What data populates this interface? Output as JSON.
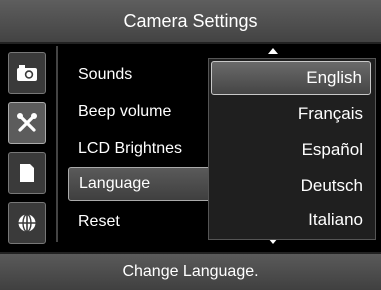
{
  "header": {
    "title": "Camera Settings"
  },
  "sidebar": {
    "tabs": [
      {
        "icon": "camera-icon",
        "active": false
      },
      {
        "icon": "tools-icon",
        "active": true
      },
      {
        "icon": "memory-card-icon",
        "active": false
      },
      {
        "icon": "globe-icon",
        "active": false
      }
    ]
  },
  "menu": {
    "items": [
      {
        "label": "Sounds"
      },
      {
        "label": "Beep volume"
      },
      {
        "label": "LCD Brightnes"
      },
      {
        "label": "Language",
        "selected": true
      },
      {
        "label": "Reset"
      }
    ]
  },
  "language_dropdown": {
    "options": [
      {
        "label": "English",
        "selected": true
      },
      {
        "label": "Français"
      },
      {
        "label": "Español"
      },
      {
        "label": "Deutsch"
      },
      {
        "label": "Italiano"
      }
    ]
  },
  "status": {
    "text": "Change Language."
  },
  "colors": {
    "highlight": "#5a5a5a",
    "background": "#000000",
    "text": "#ffffff"
  }
}
